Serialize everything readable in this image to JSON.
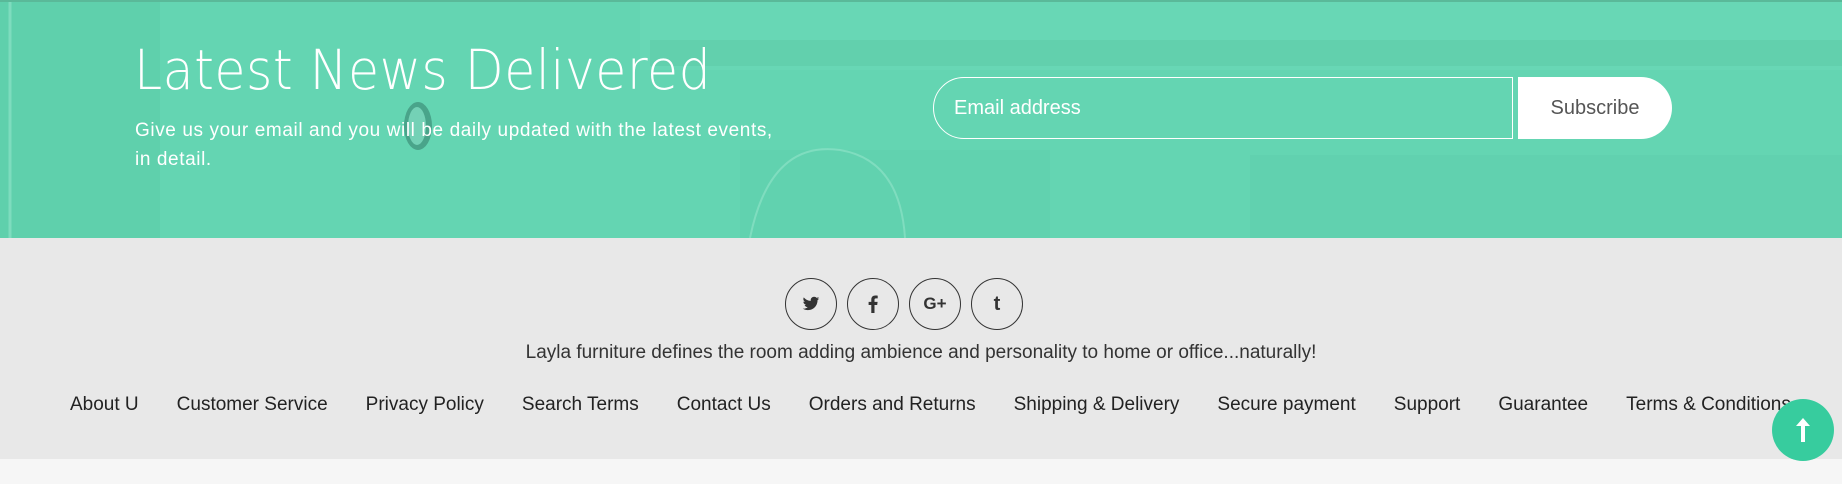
{
  "newsletter": {
    "title": "Latest News Delivered",
    "subtitle": "Give us your email and you will be daily updated with the latest events, in detail.",
    "email_placeholder": "Email address",
    "subscribe_label": "Subscribe",
    "background_color": "#64d5b2"
  },
  "footer": {
    "social": [
      {
        "icon": "twitter-icon",
        "glyph": "t"
      },
      {
        "icon": "facebook-icon",
        "glyph": "f"
      },
      {
        "icon": "google-plus-icon",
        "glyph": "G+"
      },
      {
        "icon": "tumblr-icon",
        "glyph": "t"
      }
    ],
    "tagline": "Layla furniture defines the room adding ambience and personality to home or office...naturally!",
    "links": [
      "About U",
      "Customer Service",
      "Privacy Policy",
      "Search Terms",
      "Contact Us",
      "Orders and Returns",
      "Shipping & Delivery",
      "Secure payment",
      "Support",
      "Guarantee",
      "Terms & Conditions"
    ],
    "background_color": "#e8e8e8"
  },
  "scroll_top": {
    "icon": "arrow-up-icon",
    "color": "#37cc9e"
  }
}
